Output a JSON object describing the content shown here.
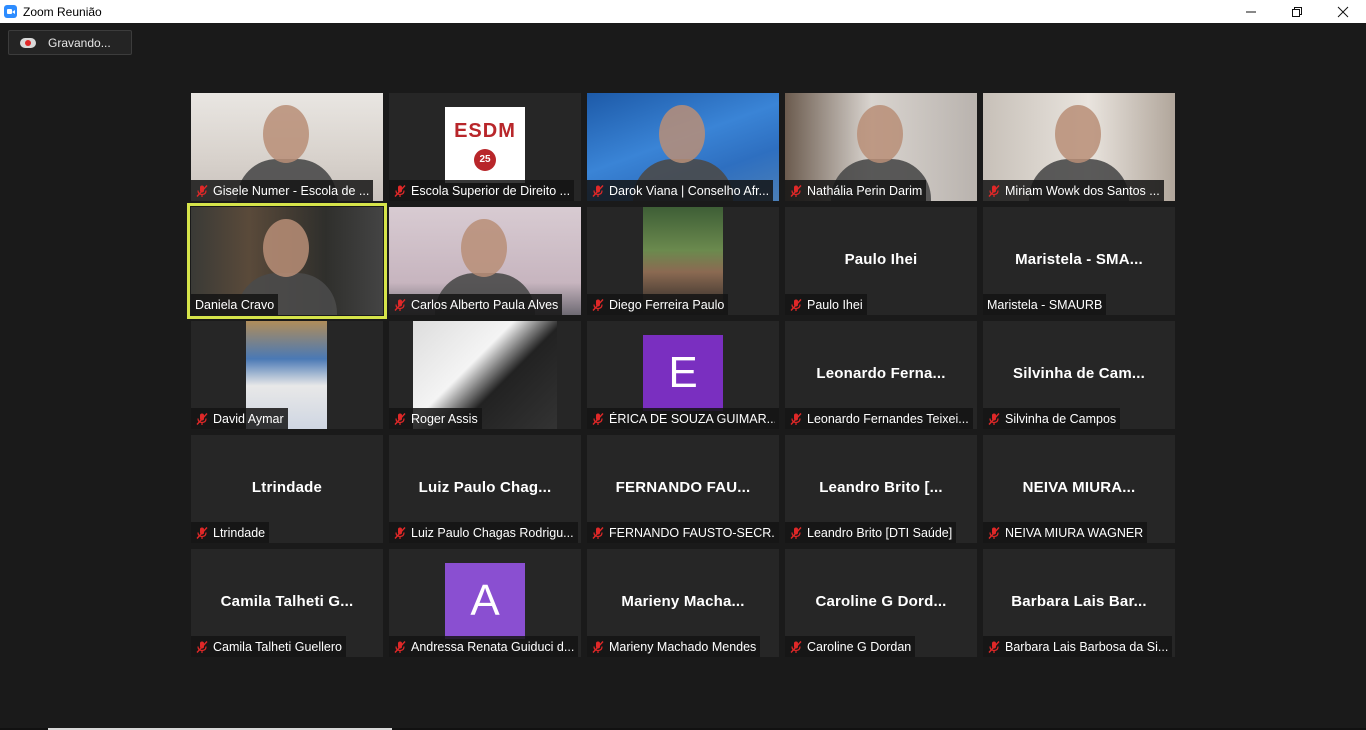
{
  "window": {
    "title": "Zoom Reunião",
    "controls": [
      "minimize",
      "restore",
      "close"
    ]
  },
  "recording": {
    "label": "Gravando..."
  },
  "colors": {
    "avatar_purple": "#7a2fc0",
    "avatar_lilac": "#8a4fd1",
    "active_speaker": "#d6e44a"
  },
  "participants": [
    {
      "label": "Gisele Numer - Escola de ...",
      "muted": true,
      "kind": "video"
    },
    {
      "label": "Escola Superior de Direito ...",
      "muted": true,
      "kind": "logo",
      "logo_text": "ESDM",
      "logo_badge": "25"
    },
    {
      "label": "Darok Viana | Conselho Afr...",
      "muted": true,
      "kind": "video"
    },
    {
      "label": "Nathália Perin Darim",
      "muted": true,
      "kind": "video"
    },
    {
      "label": "Miriam Wowk dos Santos ...",
      "muted": true,
      "kind": "video"
    },
    {
      "label": "Daniela Cravo",
      "muted": false,
      "kind": "video",
      "active": true
    },
    {
      "label": "Carlos Alberto Paula Alves",
      "muted": true,
      "kind": "video"
    },
    {
      "label": "Diego Ferreira Paulo",
      "muted": true,
      "kind": "photo"
    },
    {
      "label": "Paulo Ihei",
      "muted": true,
      "kind": "name",
      "big": "Paulo Ihei"
    },
    {
      "label": "Maristela - SMAURB",
      "muted": false,
      "kind": "name",
      "big": "Maristela - SMA..."
    },
    {
      "label": "David Aymar",
      "muted": true,
      "kind": "photo"
    },
    {
      "label": "Roger Assis",
      "muted": true,
      "kind": "photo"
    },
    {
      "label": "ÉRICA DE SOUZA GUIMAR...",
      "muted": true,
      "kind": "avatar",
      "initial": "E"
    },
    {
      "label": "Leonardo Fernandes Teixei...",
      "muted": true,
      "kind": "name",
      "big": "Leonardo Ferna..."
    },
    {
      "label": "Silvinha de Campos",
      "muted": true,
      "kind": "name",
      "big": "Silvinha de Cam..."
    },
    {
      "label": "Ltrindade",
      "muted": true,
      "kind": "name",
      "big": "Ltrindade"
    },
    {
      "label": "Luiz Paulo Chagas Rodrigu...",
      "muted": true,
      "kind": "name",
      "big": "Luiz Paulo Chag..."
    },
    {
      "label": "FERNANDO FAUSTO-SECR...",
      "muted": true,
      "kind": "name",
      "big": "FERNANDO FAU..."
    },
    {
      "label": "Leandro Brito [DTI Saúde]",
      "muted": true,
      "kind": "name",
      "big": "Leandro Brito [..."
    },
    {
      "label": "NEIVA MIURA WAGNER",
      "muted": true,
      "kind": "name",
      "big": "NEIVA MIURA..."
    },
    {
      "label": "Camila Talheti Guellero",
      "muted": true,
      "kind": "name",
      "big": "Camila Talheti G..."
    },
    {
      "label": "Andressa Renata Guiduci d...",
      "muted": true,
      "kind": "avatar",
      "initial": "A"
    },
    {
      "label": "Marieny Machado Mendes",
      "muted": true,
      "kind": "name",
      "big": "Marieny Macha..."
    },
    {
      "label": "Caroline G Dordan",
      "muted": true,
      "kind": "name",
      "big": "Caroline G Dord..."
    },
    {
      "label": "Barbara Lais Barbosa da Si...",
      "muted": true,
      "kind": "name",
      "big": "Barbara Lais Bar..."
    }
  ]
}
